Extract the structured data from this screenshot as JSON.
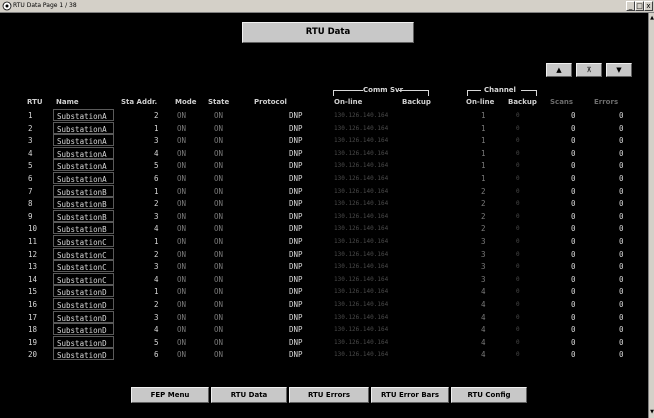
{
  "window": {
    "title": "RTU Data Page 1 / 38",
    "min": "_",
    "max": "□",
    "close": "x"
  },
  "header": {
    "title": "RTU Data"
  },
  "scroll_buttons": {
    "up": "▲",
    "top": "⊼",
    "down": "▼"
  },
  "groups": {
    "comm_svr": "Comm Svr",
    "channel": "Channel"
  },
  "columns": {
    "rtu": "RTU",
    "name": "Name",
    "sta_addr": "Sta Addr.",
    "mode": "Mode",
    "state": "State",
    "protocol": "Protocol",
    "online": "On-line",
    "backup": "Backup",
    "ch_online": "On-line",
    "ch_backup": "Backup",
    "scans": "Scans",
    "errors": "Errors"
  },
  "rows": [
    {
      "rtu": "1",
      "name": "SubstationA",
      "sta": "2",
      "mode": "ON",
      "state": "ON",
      "protocol": "DNP",
      "ip": "130.126.140.164",
      "ch": "1",
      "chb": "0",
      "scans": "0",
      "errors": "0"
    },
    {
      "rtu": "2",
      "name": "SubstationA",
      "sta": "1",
      "mode": "ON",
      "state": "ON",
      "protocol": "DNP",
      "ip": "130.126.140.164",
      "ch": "1",
      "chb": "0",
      "scans": "0",
      "errors": "0"
    },
    {
      "rtu": "3",
      "name": "SubstationA",
      "sta": "3",
      "mode": "ON",
      "state": "ON",
      "protocol": "DNP",
      "ip": "130.126.140.164",
      "ch": "1",
      "chb": "0",
      "scans": "0",
      "errors": "0"
    },
    {
      "rtu": "4",
      "name": "SubstationA",
      "sta": "4",
      "mode": "ON",
      "state": "ON",
      "protocol": "DNP",
      "ip": "130.126.140.164",
      "ch": "1",
      "chb": "0",
      "scans": "0",
      "errors": "0"
    },
    {
      "rtu": "5",
      "name": "SubstationA",
      "sta": "5",
      "mode": "ON",
      "state": "ON",
      "protocol": "DNP",
      "ip": "130.126.140.164",
      "ch": "1",
      "chb": "0",
      "scans": "0",
      "errors": "0"
    },
    {
      "rtu": "6",
      "name": "SubstationA",
      "sta": "6",
      "mode": "ON",
      "state": "ON",
      "protocol": "DNP",
      "ip": "130.126.140.164",
      "ch": "1",
      "chb": "0",
      "scans": "0",
      "errors": "0"
    },
    {
      "rtu": "7",
      "name": "SubstationB",
      "sta": "1",
      "mode": "ON",
      "state": "ON",
      "protocol": "DNP",
      "ip": "130.126.140.164",
      "ch": "2",
      "chb": "0",
      "scans": "0",
      "errors": "0"
    },
    {
      "rtu": "8",
      "name": "SubstationB",
      "sta": "2",
      "mode": "ON",
      "state": "ON",
      "protocol": "DNP",
      "ip": "130.126.140.164",
      "ch": "2",
      "chb": "0",
      "scans": "0",
      "errors": "0"
    },
    {
      "rtu": "9",
      "name": "SubstationB",
      "sta": "3",
      "mode": "ON",
      "state": "ON",
      "protocol": "DNP",
      "ip": "130.126.140.164",
      "ch": "2",
      "chb": "0",
      "scans": "0",
      "errors": "0"
    },
    {
      "rtu": "10",
      "name": "SubstationB",
      "sta": "4",
      "mode": "ON",
      "state": "ON",
      "protocol": "DNP",
      "ip": "130.126.140.164",
      "ch": "2",
      "chb": "0",
      "scans": "0",
      "errors": "0"
    },
    {
      "rtu": "11",
      "name": "SubstationC",
      "sta": "1",
      "mode": "ON",
      "state": "ON",
      "protocol": "DNP",
      "ip": "130.126.140.164",
      "ch": "3",
      "chb": "0",
      "scans": "0",
      "errors": "0"
    },
    {
      "rtu": "12",
      "name": "SubstationC",
      "sta": "2",
      "mode": "ON",
      "state": "ON",
      "protocol": "DNP",
      "ip": "130.126.140.164",
      "ch": "3",
      "chb": "0",
      "scans": "0",
      "errors": "0"
    },
    {
      "rtu": "13",
      "name": "SubstationC",
      "sta": "3",
      "mode": "ON",
      "state": "ON",
      "protocol": "DNP",
      "ip": "130.126.140.164",
      "ch": "3",
      "chb": "0",
      "scans": "0",
      "errors": "0"
    },
    {
      "rtu": "14",
      "name": "SubstationC",
      "sta": "4",
      "mode": "ON",
      "state": "ON",
      "protocol": "DNP",
      "ip": "130.126.140.164",
      "ch": "3",
      "chb": "0",
      "scans": "0",
      "errors": "0"
    },
    {
      "rtu": "15",
      "name": "SubstationD",
      "sta": "1",
      "mode": "ON",
      "state": "ON",
      "protocol": "DNP",
      "ip": "130.126.140.164",
      "ch": "4",
      "chb": "0",
      "scans": "0",
      "errors": "0"
    },
    {
      "rtu": "16",
      "name": "SubstationD",
      "sta": "2",
      "mode": "ON",
      "state": "ON",
      "protocol": "DNP",
      "ip": "130.126.140.164",
      "ch": "4",
      "chb": "0",
      "scans": "0",
      "errors": "0"
    },
    {
      "rtu": "17",
      "name": "SubstationD",
      "sta": "3",
      "mode": "ON",
      "state": "ON",
      "protocol": "DNP",
      "ip": "130.126.140.164",
      "ch": "4",
      "chb": "0",
      "scans": "0",
      "errors": "0"
    },
    {
      "rtu": "18",
      "name": "SubstationD",
      "sta": "4",
      "mode": "ON",
      "state": "ON",
      "protocol": "DNP",
      "ip": "130.126.140.164",
      "ch": "4",
      "chb": "0",
      "scans": "0",
      "errors": "0"
    },
    {
      "rtu": "19",
      "name": "SubstationD",
      "sta": "5",
      "mode": "ON",
      "state": "ON",
      "protocol": "DNP",
      "ip": "130.126.140.164",
      "ch": "4",
      "chb": "0",
      "scans": "0",
      "errors": "0"
    },
    {
      "rtu": "20",
      "name": "SubstationD",
      "sta": "6",
      "mode": "ON",
      "state": "ON",
      "protocol": "DNP",
      "ip": "130.126.140.164",
      "ch": "4",
      "chb": "0",
      "scans": "0",
      "errors": "0"
    }
  ],
  "footer": {
    "fep_menu": "FEP Menu",
    "rtu_data": "RTU Data",
    "rtu_errors": "RTU Errors",
    "rtu_error_bars": "RTU Error Bars",
    "rtu_config": "RTU Config"
  }
}
